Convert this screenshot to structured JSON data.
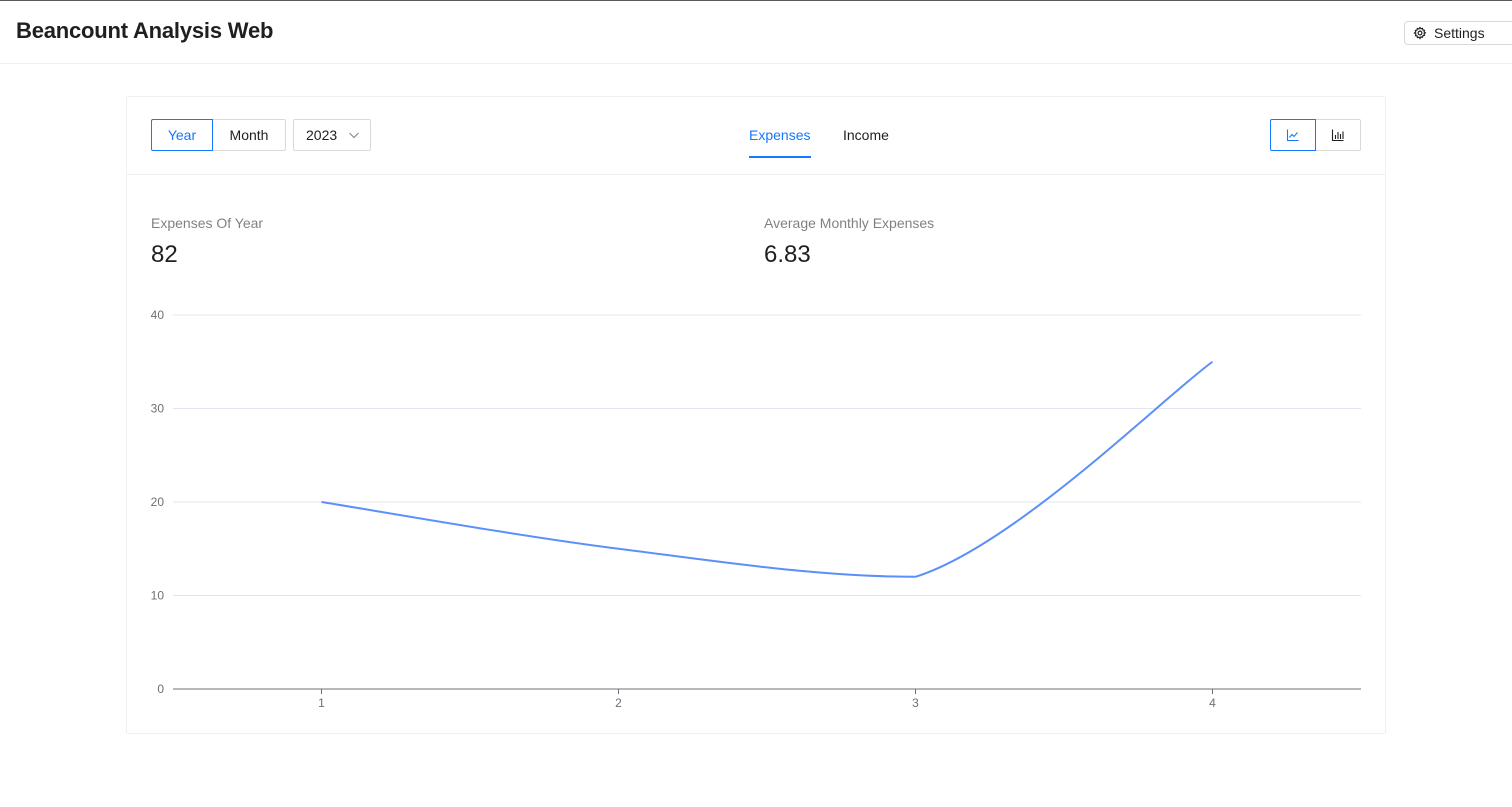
{
  "app": {
    "title": "Beancount Analysis Web"
  },
  "header": {
    "settings_label": "Settings",
    "settings_icon": "gear-icon"
  },
  "controls": {
    "period_options": [
      "Year",
      "Month"
    ],
    "period_selected": "Year",
    "year_value": "2023",
    "tabs": [
      {
        "label": "Expenses",
        "active": true
      },
      {
        "label": "Income",
        "active": false
      }
    ],
    "chart_view_options": [
      {
        "icon": "line-chart-icon",
        "active": true
      },
      {
        "icon": "bar-chart-icon",
        "active": false
      }
    ]
  },
  "stats": [
    {
      "label": "Expenses Of Year",
      "value": "82"
    },
    {
      "label": "Average Monthly Expenses",
      "value": "6.83"
    }
  ],
  "colors": {
    "accent": "#1677ff",
    "series": "#5b8ff9"
  },
  "chart_data": {
    "type": "line",
    "x": [
      "1",
      "2",
      "3",
      "4"
    ],
    "series": [
      {
        "values": [
          20,
          15,
          12,
          35
        ]
      }
    ],
    "ylim": [
      0,
      40
    ],
    "yticks": [
      0,
      10,
      20,
      30,
      40
    ],
    "grid": true,
    "smooth": true
  }
}
